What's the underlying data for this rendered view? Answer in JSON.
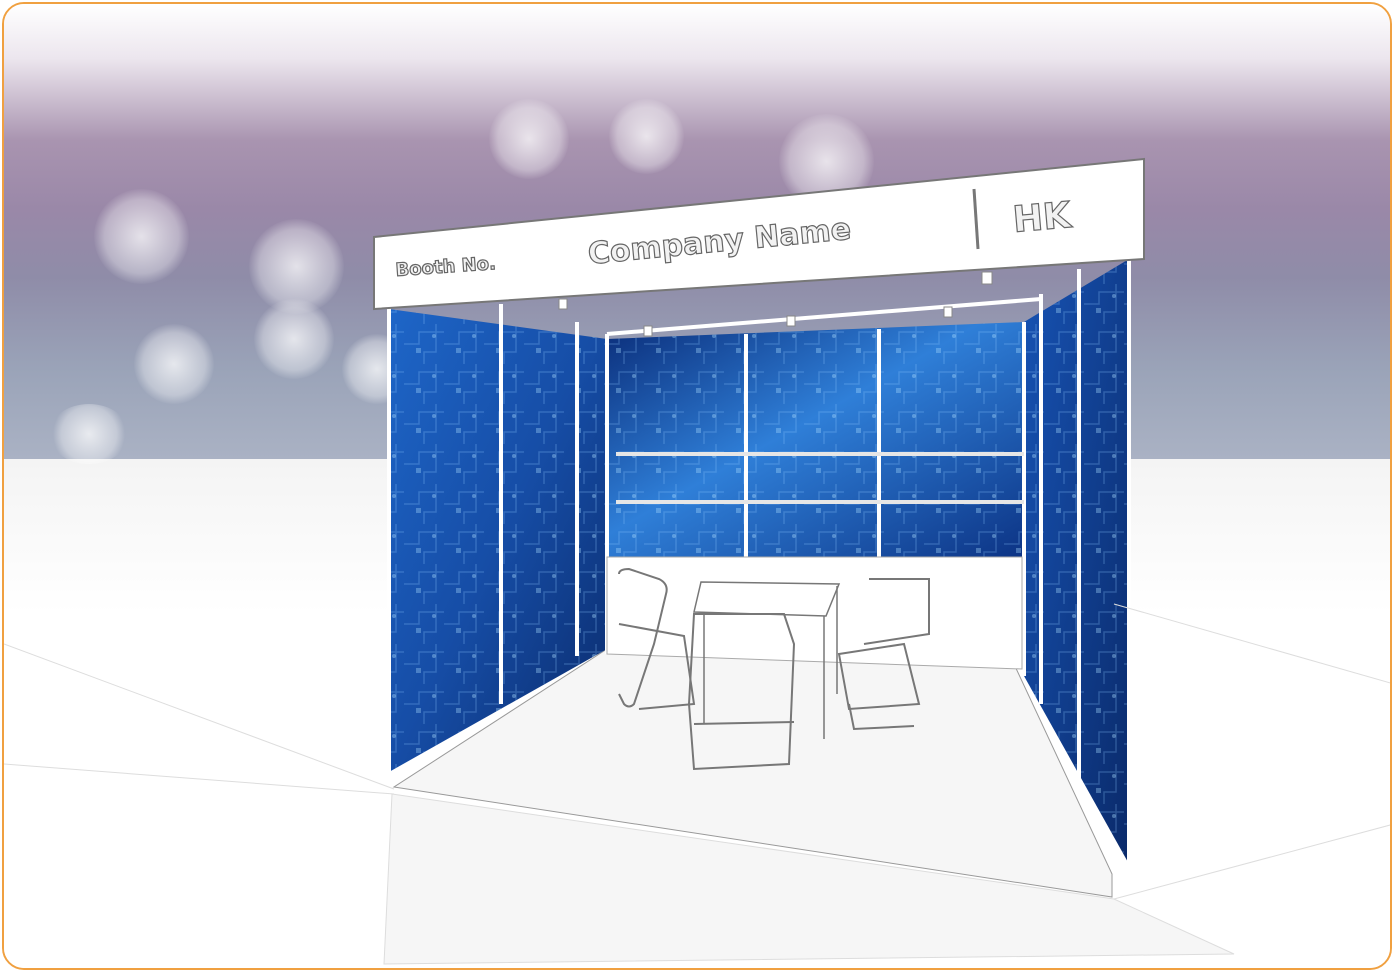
{
  "fascia": {
    "booth_label": "Booth No.",
    "company_label": "Company Name",
    "region_label": "HK"
  },
  "colors": {
    "frame_border": "#f0a040",
    "panel_blue_dark": "#0b2a6e",
    "panel_blue_light": "#2f7fd8"
  }
}
